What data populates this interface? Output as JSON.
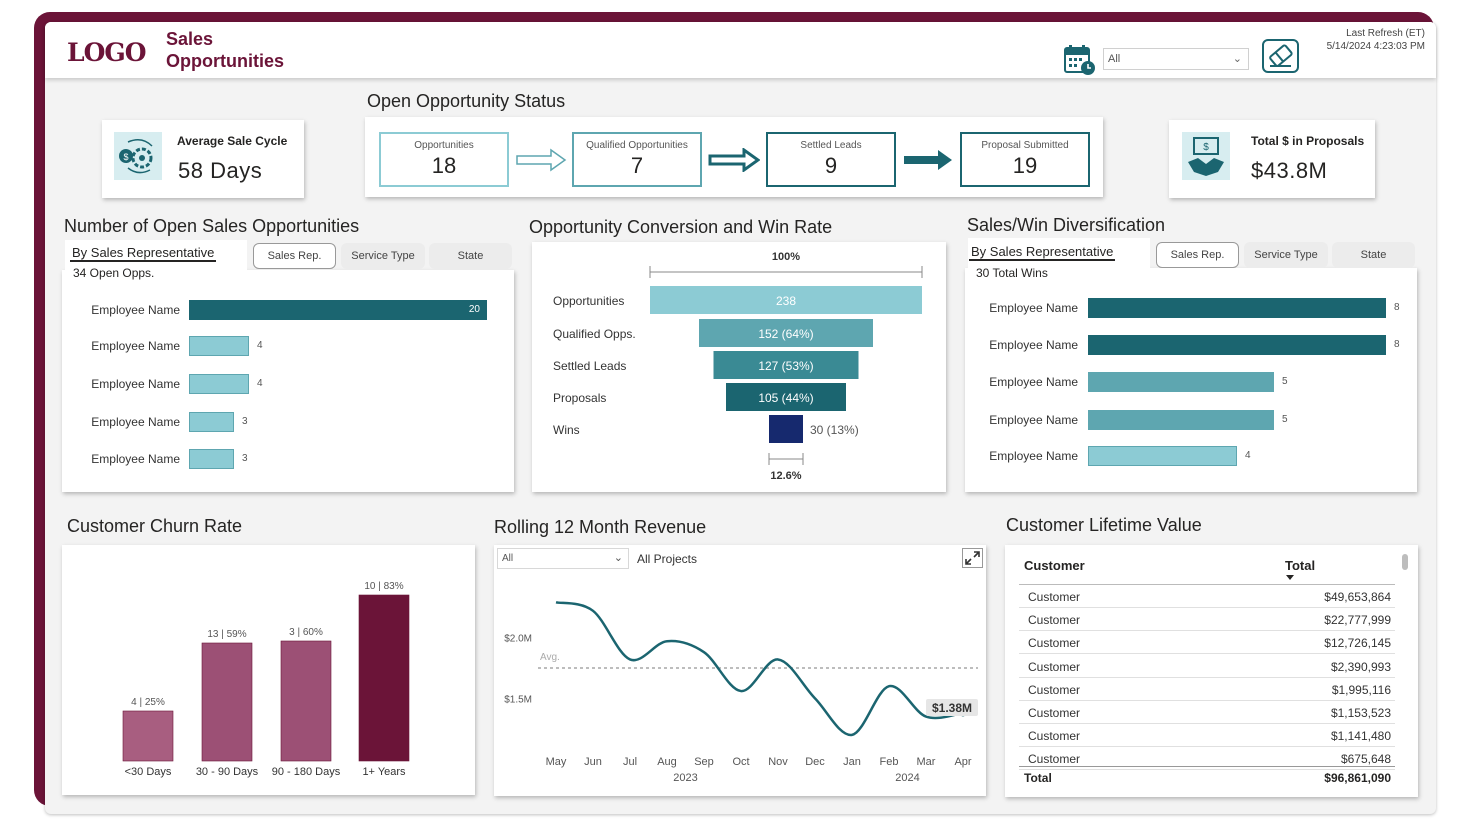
{
  "header": {
    "logo": "LOGO",
    "title_line1": "Sales",
    "title_line2": "Opportunities",
    "date_filter": "All",
    "refresh_label": "Last Refresh (ET)",
    "refresh_time": "5/14/2024 4:23:03 PM"
  },
  "avg_cycle": {
    "label": "Average Sale Cycle",
    "value": "58 Days"
  },
  "status": {
    "title": "Open Opportunity Status",
    "stages": [
      {
        "label": "Opportunities",
        "value": "18"
      },
      {
        "label": "Qualified Opportunities",
        "value": "7"
      },
      {
        "label": "Settled Leads",
        "value": "9"
      },
      {
        "label": "Proposal Submitted",
        "value": "19"
      }
    ]
  },
  "proposals": {
    "label": "Total $ in Proposals",
    "value": "$43.8M"
  },
  "open_opps": {
    "title": "Number of Open Sales Opportunities",
    "tab": "By Sales Representative",
    "subtitle": "34 Open Opps.",
    "pills": [
      "Sales Rep.",
      "Service Type",
      "State"
    ],
    "rows": [
      {
        "name": "Employee Name",
        "value": 20
      },
      {
        "name": "Employee Name",
        "value": 4
      },
      {
        "name": "Employee Name",
        "value": 4
      },
      {
        "name": "Employee Name",
        "value": 3
      },
      {
        "name": "Employee Name",
        "value": 3
      }
    ]
  },
  "funnel": {
    "title": "Opportunity Conversion and Win Rate",
    "top_label": "100%",
    "bottom_label": "12.6%",
    "rows": [
      {
        "name": "Opportunities",
        "value": 238,
        "label": "238",
        "color": "#8ccbd4"
      },
      {
        "name": "Qualified Opps.",
        "value": 152,
        "label": "152 (64%)",
        "color": "#5ea6b0"
      },
      {
        "name": "Settled Leads",
        "value": 127,
        "label": "127 (53%)",
        "color": "#3a8a94"
      },
      {
        "name": "Proposals",
        "value": 105,
        "label": "105 (44%)",
        "color": "#1b6570"
      },
      {
        "name": "Wins",
        "value": 30,
        "label": "30 (13%)",
        "color": "#16296e"
      }
    ]
  },
  "wins": {
    "title": "Sales/Win Diversification",
    "tab": "By Sales Representative",
    "subtitle": "30 Total Wins",
    "pills": [
      "Sales Rep.",
      "Service Type",
      "State"
    ],
    "rows": [
      {
        "name": "Employee Name",
        "value": 8
      },
      {
        "name": "Employee Name",
        "value": 8
      },
      {
        "name": "Employee Name",
        "value": 5
      },
      {
        "name": "Employee Name",
        "value": 5
      },
      {
        "name": "Employee Name",
        "value": 4
      }
    ]
  },
  "churn": {
    "title": "Customer Churn Rate",
    "chart_data": {
      "type": "bar",
      "categories": [
        "<30 Days",
        "30 - 90 Days",
        "90 - 180 Days",
        "1+ Years"
      ],
      "values": [
        25,
        59,
        60,
        83
      ],
      "labels": [
        "4 | 25%",
        "13 | 59%",
        "3 | 60%",
        "10 | 83%"
      ],
      "colors": [
        "#a85e80",
        "#9c5075",
        "#9c5075",
        "#6b1438"
      ]
    }
  },
  "revenue": {
    "title": "Rolling 12 Month Revenue",
    "filter": "All",
    "filter_label": "All Projects",
    "avg_label": "Avg.",
    "end_label": "$1.38M",
    "chart_data": {
      "type": "line",
      "x": [
        "May",
        "Jun",
        "Jul",
        "Aug",
        "Sep",
        "Oct",
        "Nov",
        "Dec",
        "Jan",
        "Feb",
        "Mar",
        "Apr"
      ],
      "year_labels": [
        "2023",
        "2024"
      ],
      "y": [
        2.29,
        2.22,
        1.82,
        1.97,
        1.88,
        1.56,
        1.82,
        1.5,
        1.2,
        1.6,
        1.35,
        1.38
      ],
      "avg": 1.75,
      "ylim": [
        1.1,
        2.35
      ],
      "yticks": [
        {
          "v": 2.0,
          "label": "$2.0M"
        },
        {
          "v": 1.5,
          "label": "$1.5M"
        }
      ]
    }
  },
  "clv": {
    "title": "Customer Lifetime Value",
    "col1": "Customer",
    "col2": "Total",
    "rows": [
      {
        "customer": "Customer",
        "total": "$49,653,864"
      },
      {
        "customer": "Customer",
        "total": "$22,777,999"
      },
      {
        "customer": "Customer",
        "total": "$12,726,145"
      },
      {
        "customer": "Customer",
        "total": "$2,390,993"
      },
      {
        "customer": "Customer",
        "total": "$1,995,116"
      },
      {
        "customer": "Customer",
        "total": "$1,153,523"
      },
      {
        "customer": "Customer",
        "total": "$1,141,480"
      },
      {
        "customer": "Customer",
        "total": "$675,648"
      }
    ],
    "total_label": "Total",
    "total_value": "$96,861,090"
  }
}
